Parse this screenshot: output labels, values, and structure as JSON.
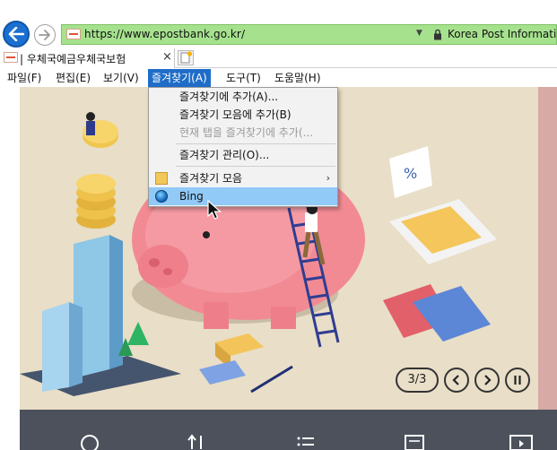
{
  "address_bar": {
    "url": "https://www.epostbank.go.kr/",
    "certificate": "Korea Post Information"
  },
  "tab": {
    "title": "| 우체국예금우체국보험",
    "close_glyph": "×"
  },
  "menu_bar": {
    "items": [
      {
        "label": "파일(F)"
      },
      {
        "label": "편집(E)"
      },
      {
        "label": "보기(V)"
      },
      {
        "label": "즐겨찾기(A)"
      },
      {
        "label": "도구(T)"
      },
      {
        "label": "도움말(H)"
      }
    ]
  },
  "favorites_menu": {
    "items": [
      {
        "label": "즐겨찾기에 추가(A)..."
      },
      {
        "label": "즐겨찾기 모음에 추가(B)"
      },
      {
        "label": "현재 탭을 즐겨찾기에 추가(..."
      },
      {
        "label": "즐겨찾기 관리(O)..."
      },
      {
        "label": "즐겨찾기 모음"
      },
      {
        "label": "Bing"
      }
    ],
    "submenu_arrow": "›"
  },
  "slider": {
    "counter": "3/3"
  },
  "colors": {
    "menu_active": "#1f6dc8",
    "hover": "#91c9f7",
    "address_bg": "#a6e28e",
    "footer": "#4c515c"
  }
}
